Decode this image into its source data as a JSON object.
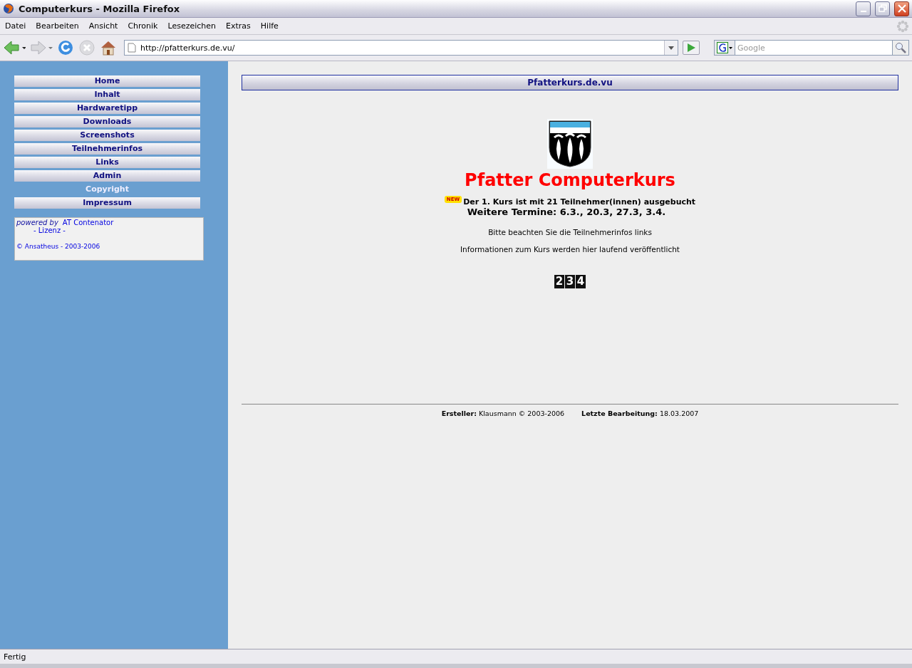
{
  "window": {
    "title": "Computerkurs - Mozilla Firefox"
  },
  "menu": [
    "Datei",
    "Bearbeiten",
    "Ansicht",
    "Chronik",
    "Lesezeichen",
    "Extras",
    "Hilfe"
  ],
  "navigation": {
    "url": "http://pfatterkurs.de.vu/",
    "search_placeholder": "Google"
  },
  "sidebar": {
    "items": [
      {
        "label": "Home",
        "selected": false
      },
      {
        "label": "Inhalt",
        "selected": false
      },
      {
        "label": "Hardwaretipp",
        "selected": false
      },
      {
        "label": "Downloads",
        "selected": false
      },
      {
        "label": "Screenshots",
        "selected": false
      },
      {
        "label": "Teilnehmerinfos",
        "selected": false
      },
      {
        "label": "Links",
        "selected": false
      },
      {
        "label": "Admin",
        "selected": false
      },
      {
        "label": "Copyright",
        "selected": true
      },
      {
        "label": "Impressum",
        "selected": false
      }
    ],
    "powered_by": {
      "prefix": "powered by",
      "product": "AT Contenator",
      "license": "- Lizenz -",
      "copyright": "© Ansatheus - 2003-2006"
    }
  },
  "content": {
    "header": "Pfatterkurs.de.vu",
    "title": "Pfatter Computerkurs",
    "new_badge": "NEW",
    "announcement": "Der 1. Kurs ist mit 21 Teilnehmer(innen) ausgebucht",
    "dates": "Weitere Termine: 6.3., 20.3, 27.3, 3.4.",
    "notes": [
      "Bitte beachten Sie die Teilnehmerinfos links",
      "Informationen zum Kurs werden hier laufend veröffentlicht"
    ],
    "counter": [
      "2",
      "3",
      "4"
    ],
    "footer": [
      "**Ersteller:** Klausmann © 2003-2006",
      "**Letzte Bearbeitung:** 18.03.2007"
    ]
  },
  "status_bar": {
    "text": "Fertig"
  }
}
